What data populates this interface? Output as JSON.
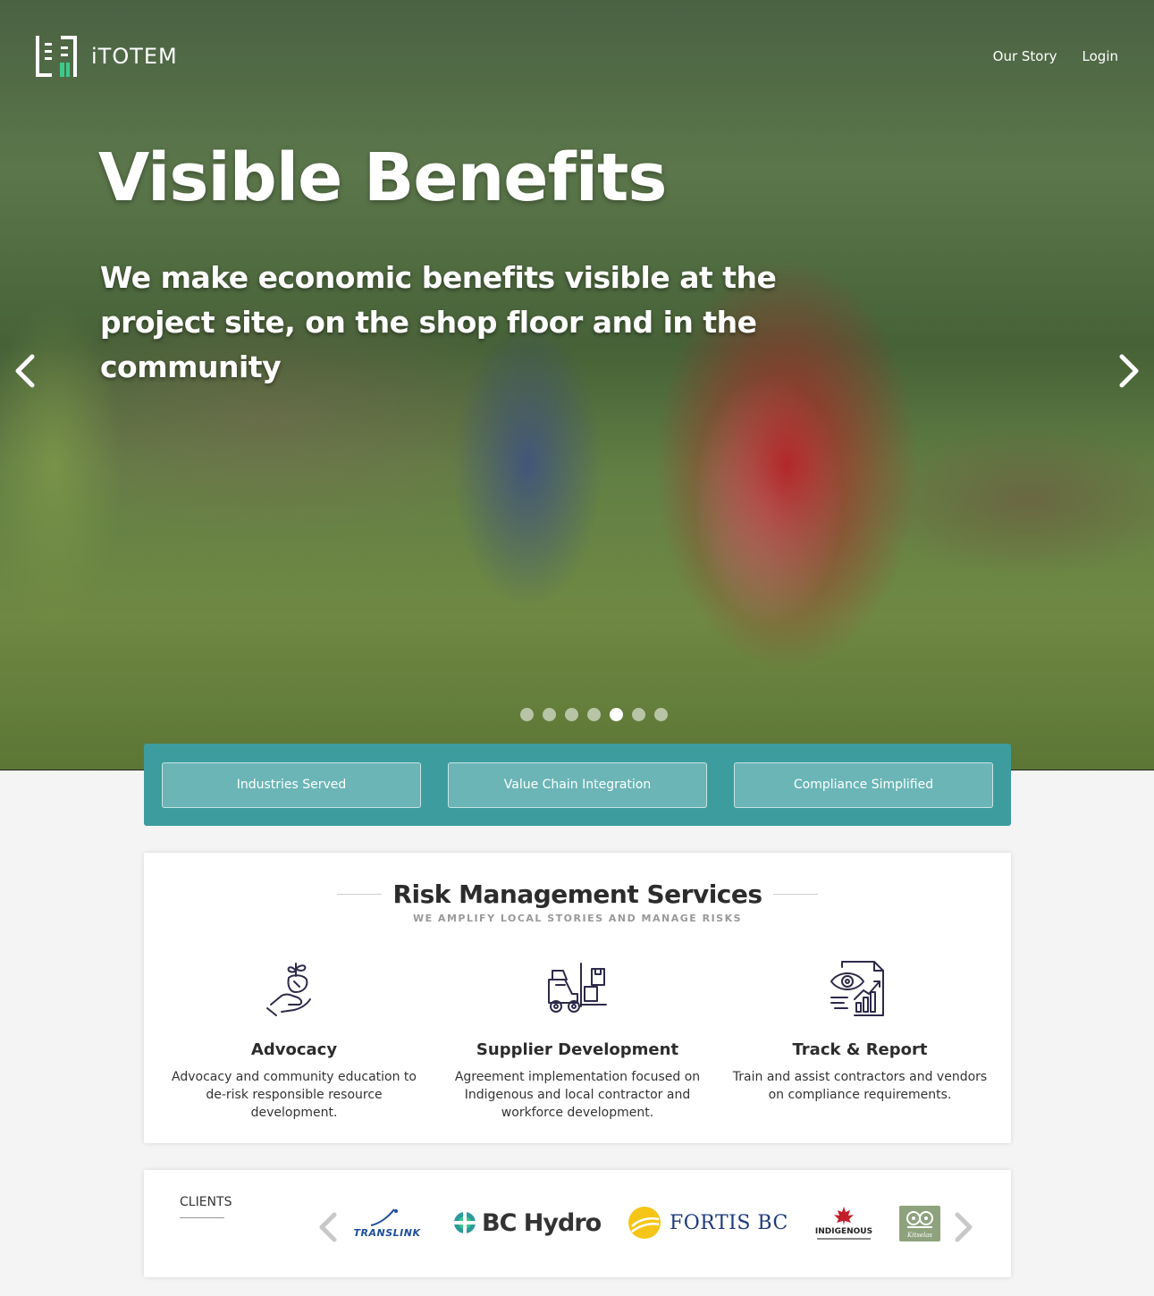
{
  "brand": {
    "name": "iTOTEM"
  },
  "nav": {
    "items": [
      "Our Story",
      "Login"
    ]
  },
  "hero": {
    "title": "Visible Benefits",
    "subtitle": "We make economic benefits visible at the project site, on the shop floor and in the community",
    "slide_count": 7,
    "active_slide_index": 4
  },
  "features": [
    "Industries Served",
    "Value Chain Integration",
    "Compliance Simplified"
  ],
  "services": {
    "title": "Risk Management Services",
    "tagline": "WE AMPLIFY LOCAL STORIES AND MANAGE RISKS",
    "items": [
      {
        "icon": "plant-in-hand-icon",
        "name": "Advocacy",
        "description": "Advocacy and community education to de-risk responsible resource development."
      },
      {
        "icon": "forklift-icon",
        "name": "Supplier Development",
        "description": "Agreement implementation focused on Indigenous and local contractor and workforce development."
      },
      {
        "icon": "report-chart-eye-icon",
        "name": "Track & Report",
        "description": "Train and assist contractors and vendors on compliance requirements."
      }
    ]
  },
  "clients": {
    "label": "CLIENTS",
    "logos": {
      "translink": "TRANSLINK",
      "bchydro": "BC Hydro",
      "fortis": "FORTIS BC",
      "indigenous": "INDIGENOUS",
      "kitselas": "Kitselas"
    }
  },
  "colors": {
    "teal": "#3d9d9e",
    "teal_button": "#6bb5b6",
    "accent_green": "#3ec98b",
    "icon_purple": "#2d2a4a"
  }
}
